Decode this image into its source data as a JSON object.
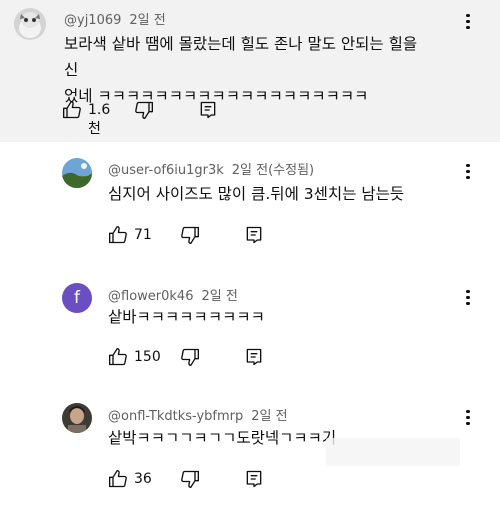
{
  "comments": [
    {
      "author": "@yj1069",
      "time": "2일 전",
      "text_line1": "보라색 샅바 땜에 몰랐는데 힐도 존나 말도 안되는 힐을 신",
      "text_line2": "었네 ㅋㅋㅋㅋㅋㅋㅋㅋㅋㅋㅋㅋㅋㅋㅋㅋㅋㅋㅋ",
      "likes": "1.6천",
      "avatar_color": "#c9c9c9"
    },
    {
      "author": "@user-of6iu1gr3k",
      "time": "2일 전(수정됨)",
      "text": "심지어 사이즈도 많이 큼.뒤에 3센치는 남는듯",
      "likes": "71",
      "avatar_color": "#4a86b8"
    },
    {
      "author": "@flower0k46",
      "time": "2일 전",
      "text": "샅바ㅋㅋㅋㅋㅋㅋㅋㅋㅋ",
      "likes": "150",
      "avatar_letter": "f",
      "avatar_color": "#6a4ec2"
    },
    {
      "author": "@onfl-Tkdtks-ybfmrp",
      "time": "2일 전",
      "text": "샅박ㅋㅋㄱㄱㅋㄱㄱ도랏넥ㄱㅋㅋ기",
      "likes": "36",
      "avatar_color": "#5b4a3a"
    }
  ]
}
